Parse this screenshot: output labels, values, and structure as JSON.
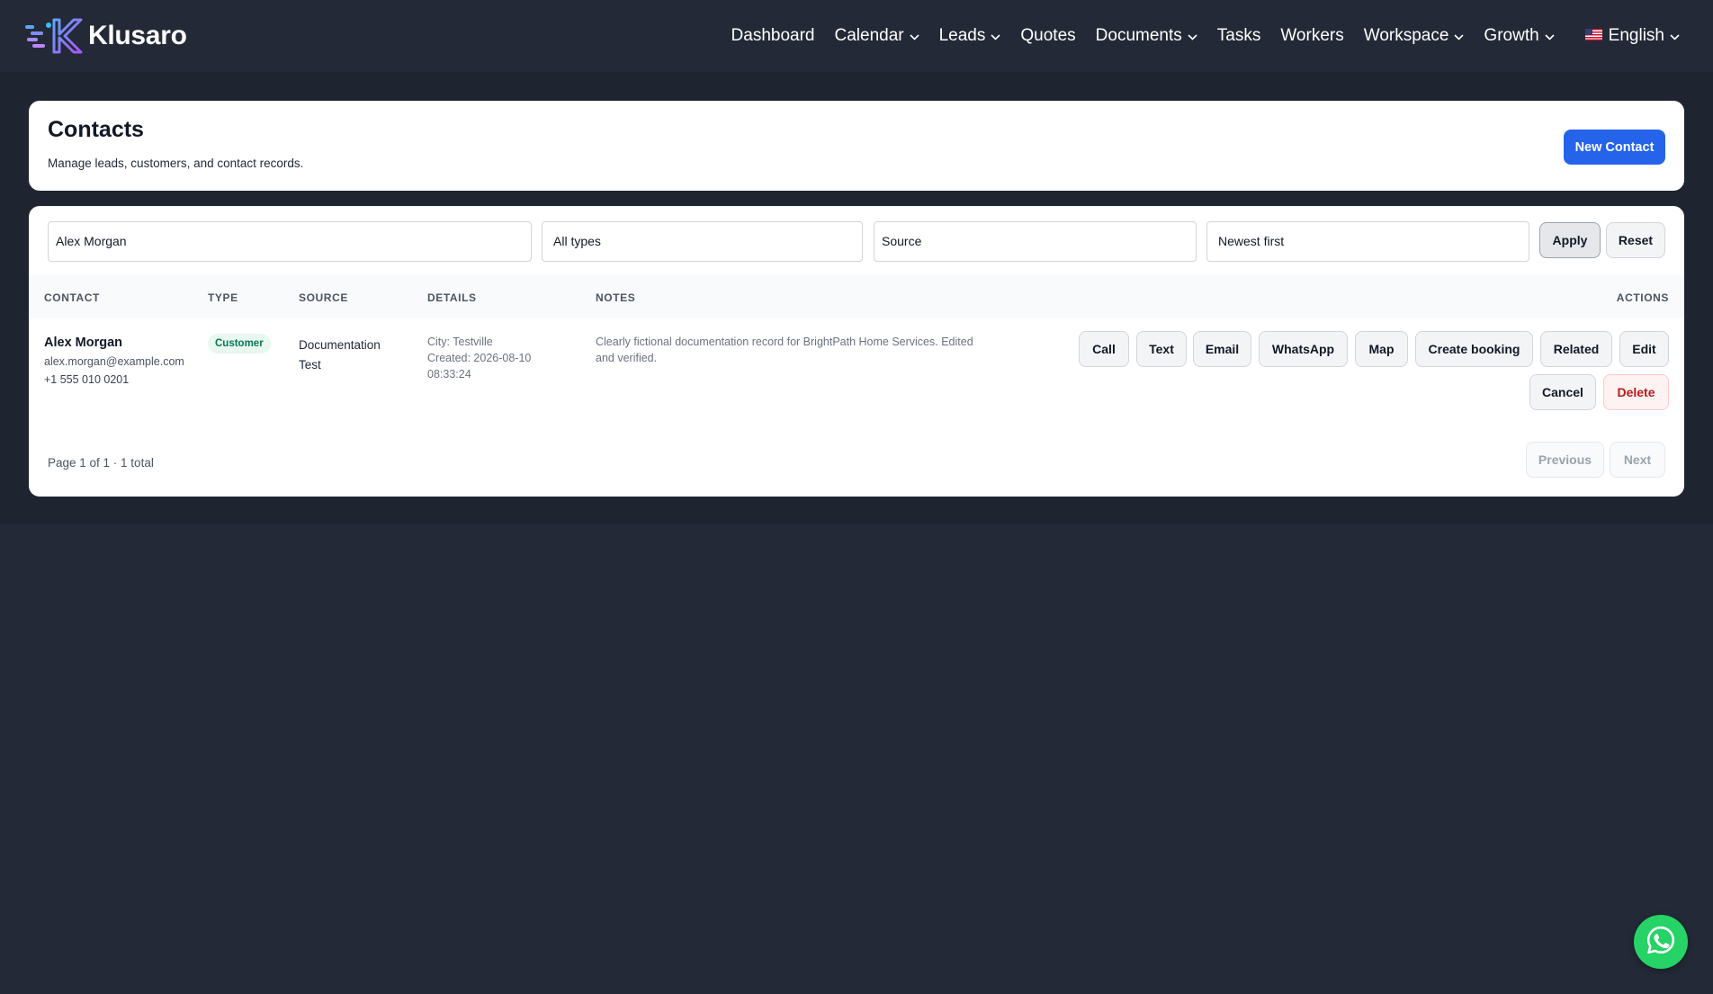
{
  "app": {
    "brand_name": "Klusaro",
    "logo_icon": "klusaro-logo-icon"
  },
  "nav": {
    "items": [
      {
        "label": "Dashboard",
        "dropdown": false
      },
      {
        "label": "Calendar",
        "dropdown": true
      },
      {
        "label": "Leads",
        "dropdown": true
      },
      {
        "label": "Quotes",
        "dropdown": false
      },
      {
        "label": "Documents",
        "dropdown": true
      },
      {
        "label": "Tasks",
        "dropdown": false
      },
      {
        "label": "Workers",
        "dropdown": false
      },
      {
        "label": "Workspace",
        "dropdown": true
      },
      {
        "label": "Growth",
        "dropdown": true
      }
    ],
    "language": {
      "label": "English",
      "icon": "us-flag-icon"
    }
  },
  "header": {
    "title": "Contacts",
    "subtitle": "Manage leads, customers, and contact records.",
    "new_button": "New Contact"
  },
  "filters": {
    "search_value": "Alex Morgan",
    "type_value": "All types",
    "source_value": "Source",
    "sort_value": "Newest first",
    "apply_label": "Apply",
    "reset_label": "Reset"
  },
  "table": {
    "columns": {
      "contact": "Contact",
      "type": "Type",
      "source": "Source",
      "details": "Details",
      "notes": "Notes",
      "actions": "Actions"
    },
    "rows": [
      {
        "name": "Alex Morgan",
        "email": "alex.morgan@example.com",
        "phone": "+1 555 010 0201",
        "type": "Customer",
        "source": "Documentation Test",
        "details_city": "City: Testville",
        "details_created": "Created: 2026-08-10 08:33:24",
        "notes": "Clearly fictional documentation record for BrightPath Home Services. Edited and verified.",
        "actions": {
          "call": "Call",
          "text": "Text",
          "email": "Email",
          "whatsapp": "WhatsApp",
          "map": "Map",
          "create_booking": "Create booking",
          "related": "Related",
          "edit": "Edit",
          "cancel": "Cancel",
          "delete": "Delete"
        }
      }
    ]
  },
  "pagination": {
    "info": "Page 1 of 1 · 1 total",
    "previous": "Previous",
    "next": "Next"
  },
  "floating": {
    "icon": "whatsapp-icon"
  },
  "colors": {
    "background": "#232936",
    "primary": "#2563eb",
    "badge_bg": "#e8f7ef",
    "badge_text": "#047857",
    "danger": "#b91c1c",
    "whatsapp": "#25d366"
  }
}
